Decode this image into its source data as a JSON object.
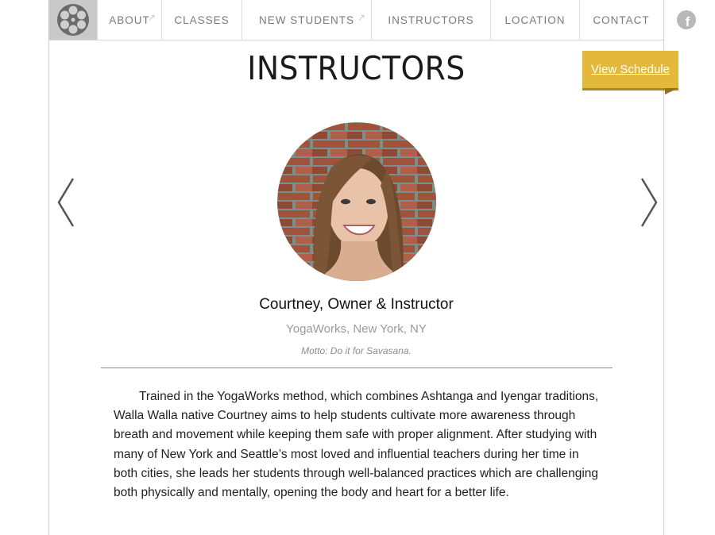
{
  "nav": {
    "items": [
      {
        "label": "ABOUT",
        "external": true
      },
      {
        "label": "CLASSES",
        "external": false
      },
      {
        "label": "NEW STUDENTS",
        "external": true
      },
      {
        "label": "INSTRUCTORS",
        "external": false
      },
      {
        "label": "LOCATION",
        "external": false
      },
      {
        "label": "CONTACT",
        "external": false
      }
    ],
    "external_glyph": "↗",
    "logo_icon": "film-reel-icon",
    "social_icon": "facebook-icon",
    "social_glyph": "f"
  },
  "page": {
    "title": "INSTRUCTORS",
    "schedule_button": "View Schedule"
  },
  "instructor": {
    "name": "Courtney, Owner & Instructor",
    "studio": "YogaWorks, New York, NY",
    "motto": "Motto: Do it for Savasana.",
    "bio": "Trained in the YogaWorks method, which combines Ashtanga and Iyengar traditions, Walla Walla native Courtney aims to help students cultivate more awareness through breath and movement while keeping them safe with proper alignment. After studying with many of New York and Seattle’s most loved and influential teachers during her time in both cities, she leads her students through well-balanced practices which are challenging both physically and mentally, opening the body and heart for a better life."
  },
  "carousel": {
    "prev_icon": "chevron-left-icon",
    "next_icon": "chevron-right-icon"
  },
  "colors": {
    "accent": "#e2b93b",
    "nav_text": "#7a7a7a",
    "logo_bg": "#c9c9c9"
  }
}
